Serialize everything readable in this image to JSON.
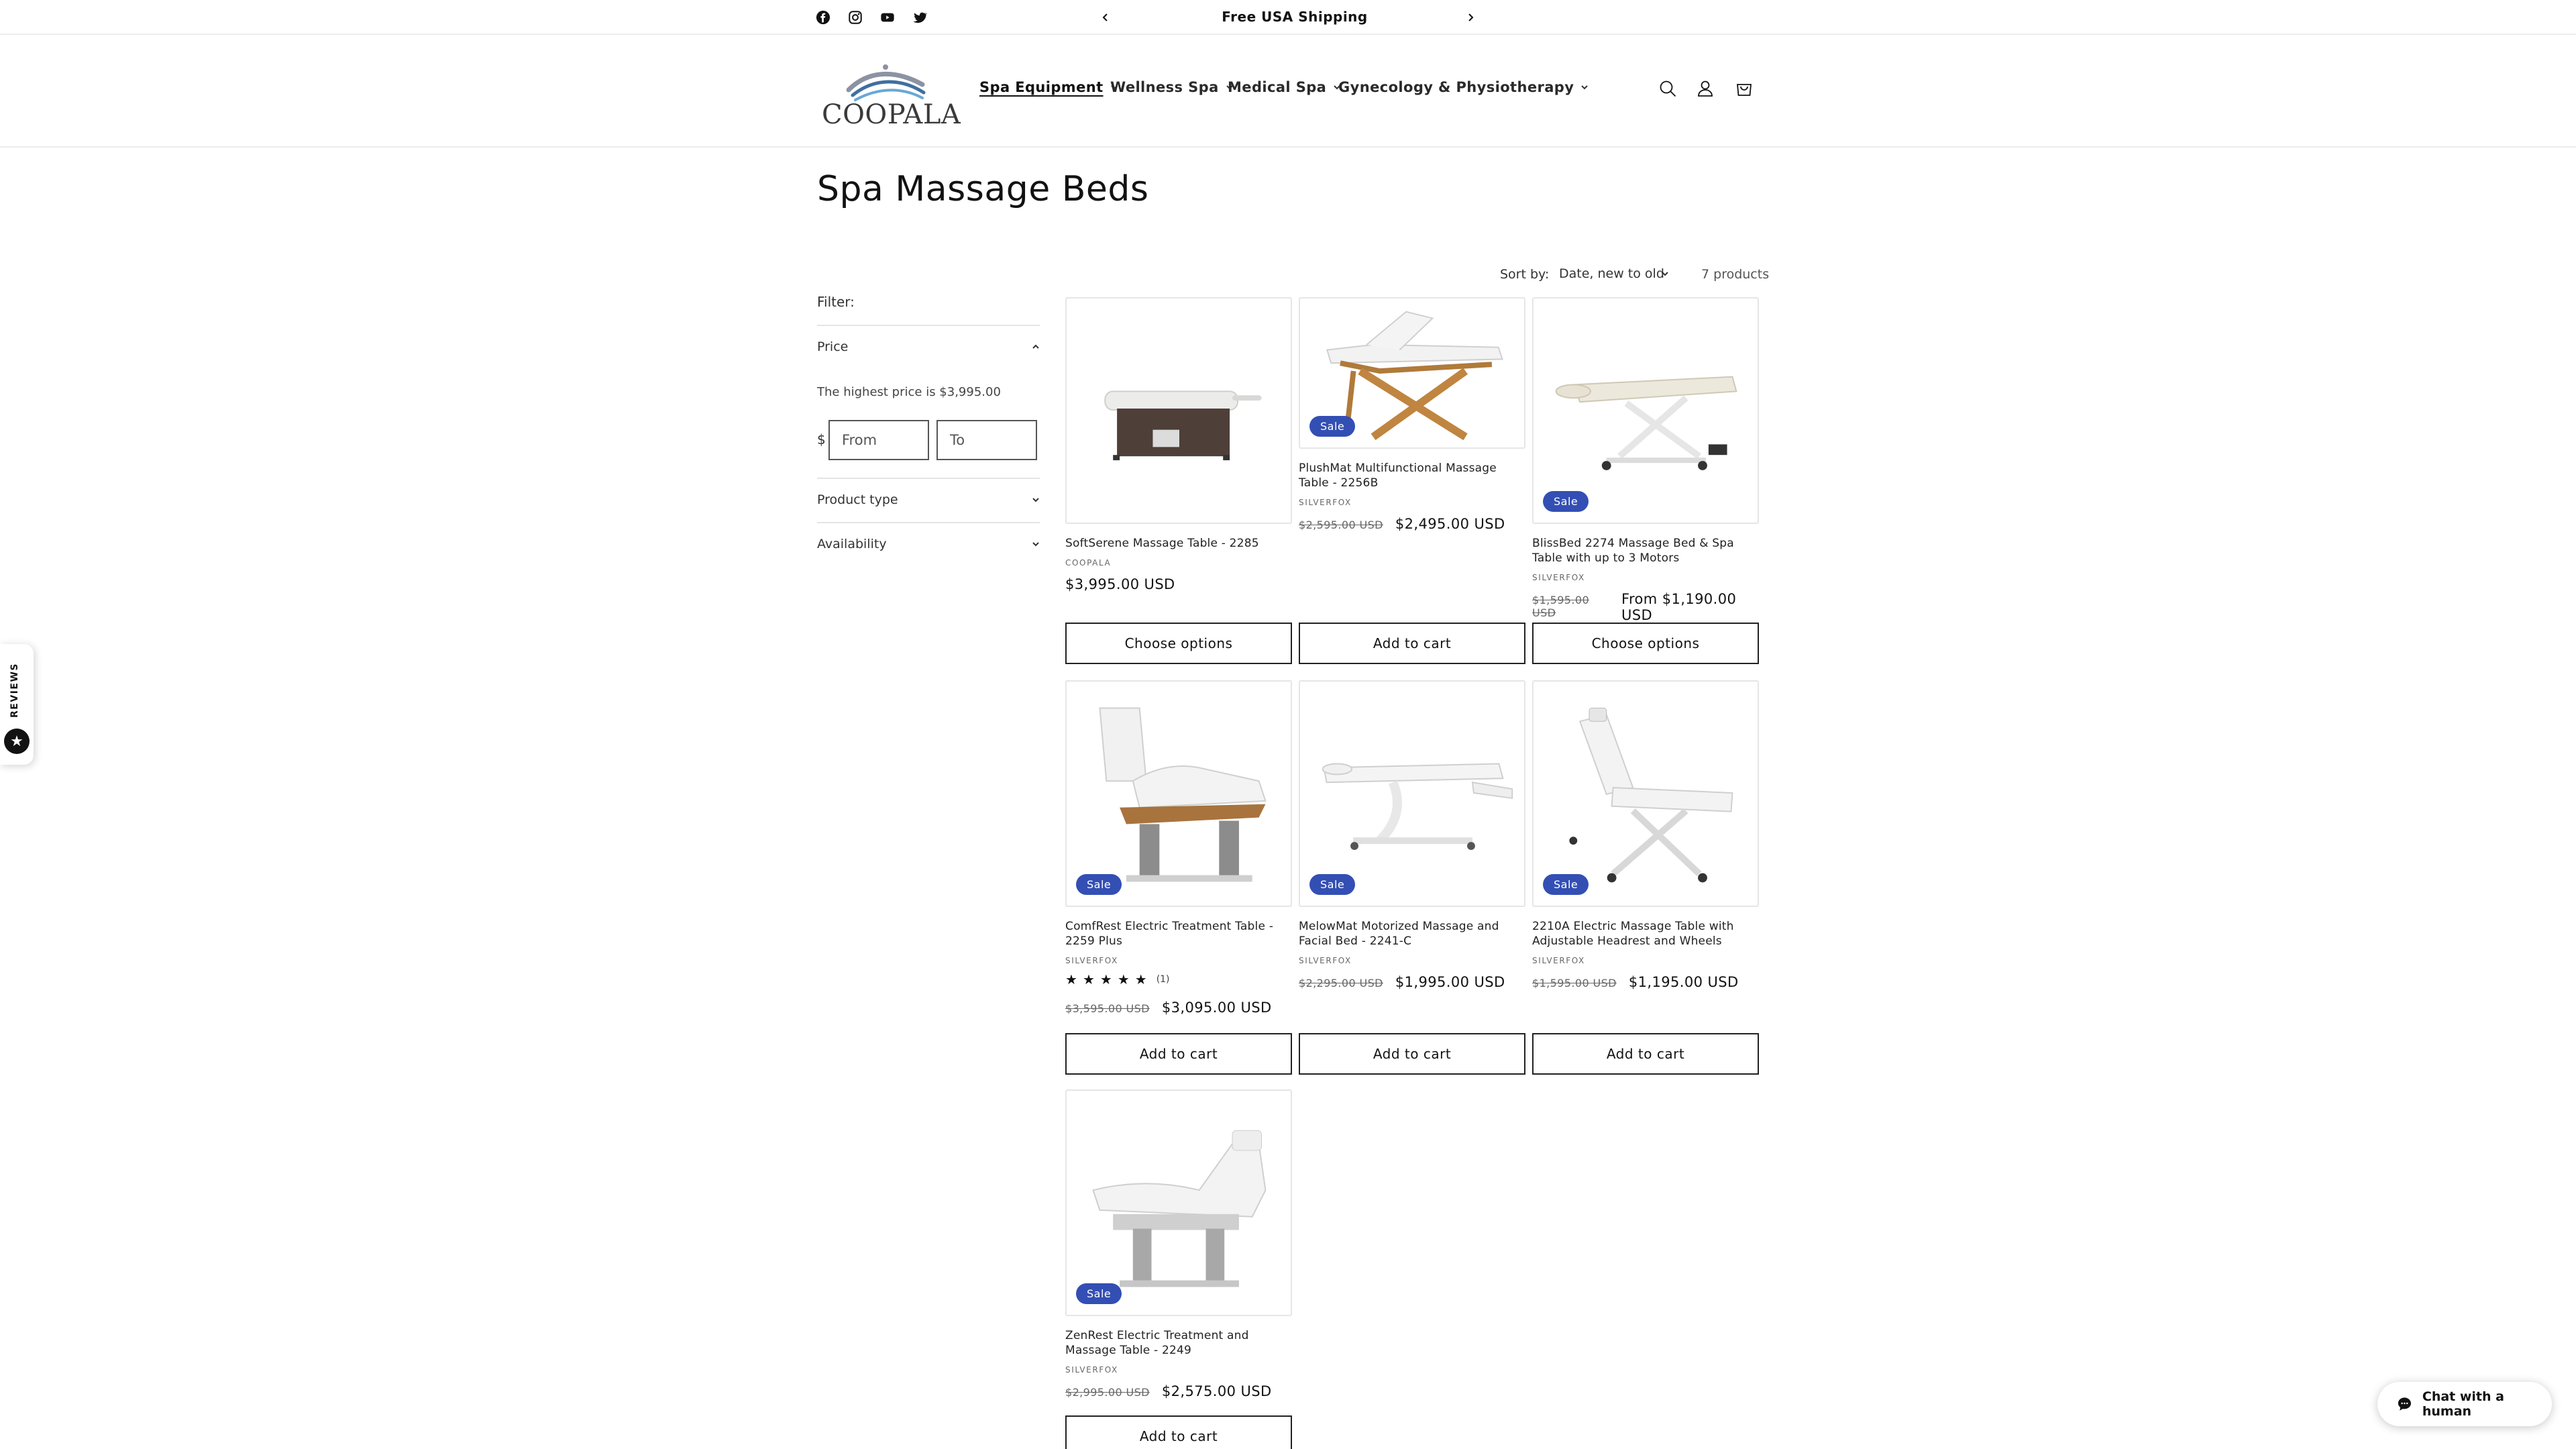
{
  "announcement": {
    "message": "Free USA Shipping"
  },
  "social": [
    "facebook-icon",
    "instagram-icon",
    "youtube-icon",
    "twitter-icon"
  ],
  "header": {
    "logo_text": "COOPALA",
    "nav": [
      {
        "label": "Spa Equipment",
        "active": true
      },
      {
        "label": "Wellness Spa"
      },
      {
        "label": "Medical Spa"
      },
      {
        "label": "Gynecology & Physiotherapy"
      }
    ]
  },
  "page": {
    "title": "Spa Massage Beds"
  },
  "sort": {
    "label": "Sort by:",
    "value": "Date, new to old",
    "count": "7 products"
  },
  "filter": {
    "label": "Filter:",
    "price_heading": "Price",
    "highest_price": "The highest price is $3,995.00",
    "currency": "$",
    "from_placeholder": "From",
    "to_placeholder": "To",
    "product_type": "Product type",
    "availability": "Availability"
  },
  "badge_text": "Sale",
  "products": [
    {
      "title": "SoftSerene Massage Table - 2285",
      "vendor": "COOPALA",
      "old_price": "",
      "price": "$3,995.00 USD",
      "button": "Choose options",
      "sale": false
    },
    {
      "title": "PlushMat Multifunctional Massage Table - 2256B",
      "vendor": "SILVERFOX",
      "old_price": "$2,595.00 USD",
      "price": "$2,495.00 USD",
      "button": "Add to cart",
      "sale": true
    },
    {
      "title": "BlissBed 2274 Massage Bed & Spa Table with up to 3 Motors",
      "vendor": "SILVERFOX",
      "old_price": "$1,595.00 USD",
      "price": "From $1,190.00 USD",
      "button": "Choose options",
      "sale": true
    },
    {
      "title": "ComfRest Electric Treatment Table - 2259 Plus",
      "vendor": "SILVERFOX",
      "old_price": "$3,595.00 USD",
      "price": "$3,095.00 USD",
      "button": "Add to cart",
      "sale": true,
      "rating": 5,
      "review_count": "(1)"
    },
    {
      "title": "MelowMat Motorized Massage and Facial Bed - 2241-C",
      "vendor": "SILVERFOX",
      "old_price": "$2,295.00 USD",
      "price": "$1,995.00 USD",
      "button": "Add to cart",
      "sale": true
    },
    {
      "title": "2210A Electric Massage Table with Adjustable Headrest and Wheels",
      "vendor": "SILVERFOX",
      "old_price": "$1,595.00 USD",
      "price": "$1,195.00 USD",
      "button": "Add to cart",
      "sale": true
    },
    {
      "title": "ZenRest Electric Treatment and Massage Table - 2249",
      "vendor": "SILVERFOX",
      "old_price": "$2,995.00 USD",
      "price": "$2,575.00 USD",
      "button": "Add to cart",
      "sale": true
    }
  ],
  "reviews_tab": {
    "label": "REVIEWS"
  },
  "chat": {
    "label": "Chat with a human"
  },
  "colors": {
    "sale_badge": "#334fb4",
    "text": "#121212",
    "border": "#e6e6e6"
  }
}
